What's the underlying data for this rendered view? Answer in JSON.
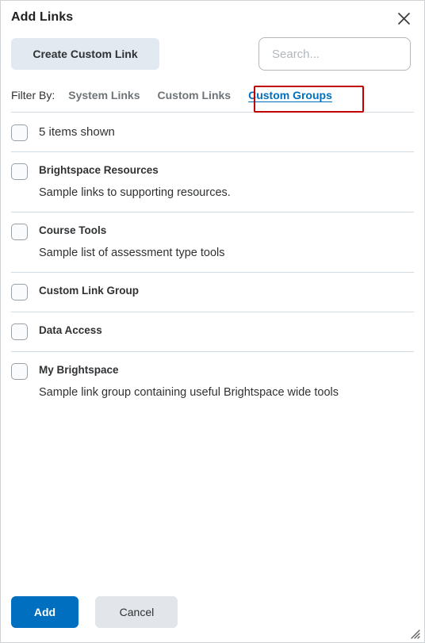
{
  "dialog": {
    "title": "Add Links",
    "close_icon": "close-icon"
  },
  "toolbar": {
    "create_custom_link_label": "Create Custom Link",
    "search": {
      "placeholder": "Search...",
      "value": "",
      "icon": "search-icon"
    }
  },
  "filter": {
    "label": "Filter By:",
    "tabs": [
      {
        "label": "System Links",
        "active": false
      },
      {
        "label": "Custom Links",
        "active": false
      },
      {
        "label": "Custom Groups",
        "active": true
      }
    ],
    "highlight_color": "#c00000"
  },
  "list": {
    "summary": "5 items shown",
    "items": [
      {
        "title": "Brightspace Resources",
        "description": "Sample links to supporting resources."
      },
      {
        "title": "Course Tools",
        "description": "Sample list of assessment type tools"
      },
      {
        "title": "Custom Link Group",
        "description": ""
      },
      {
        "title": "Data Access",
        "description": ""
      },
      {
        "title": "My Brightspace",
        "description": "Sample link group containing useful Brightspace wide tools"
      }
    ]
  },
  "footer": {
    "add_label": "Add",
    "cancel_label": "Cancel",
    "resize_icon": "resize-grip-icon"
  },
  "colors": {
    "accent": "#006fbf",
    "link": "#006fbf",
    "highlight": "#c00000",
    "button_secondary": "#e2e9f1"
  }
}
